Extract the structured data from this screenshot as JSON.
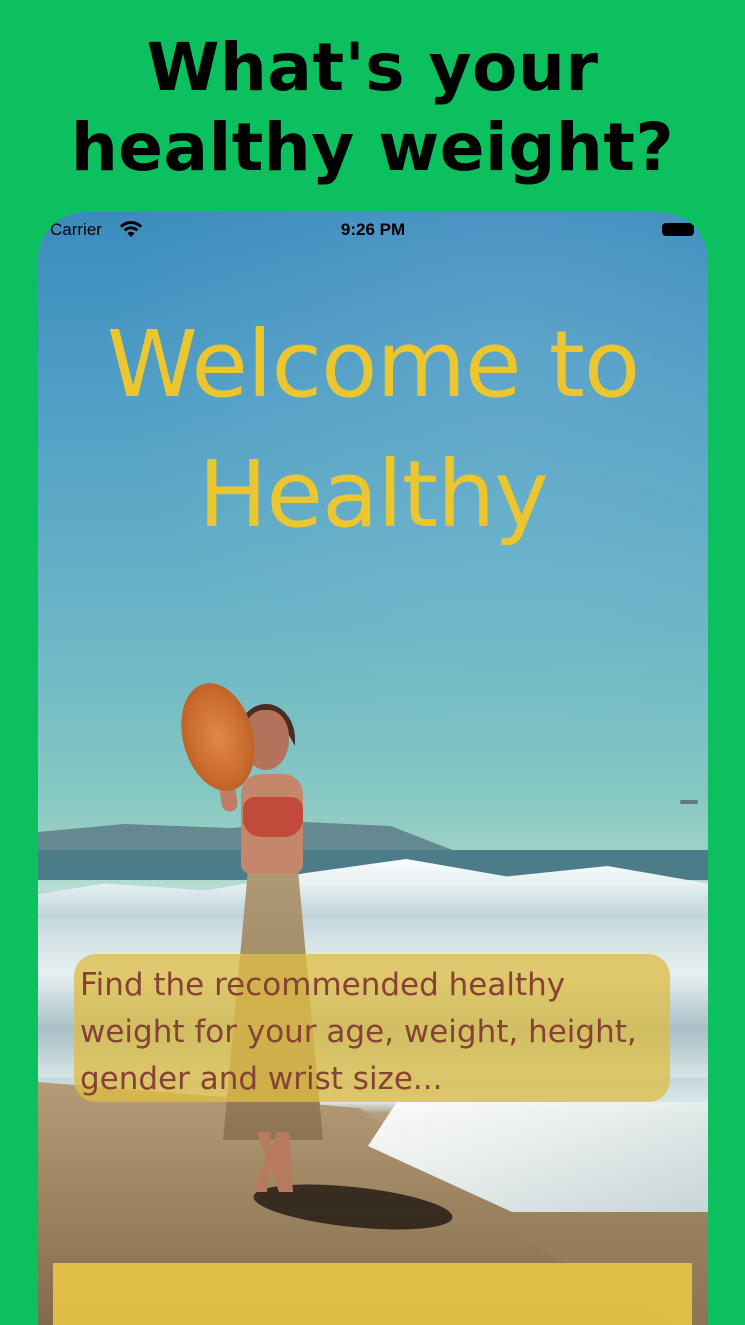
{
  "promo": {
    "headline": "What's your healthy weight?"
  },
  "status_bar": {
    "carrier": "Carrier",
    "time": "9:26 PM",
    "wifi_icon": "wifi-icon",
    "battery_icon": "battery-icon"
  },
  "welcome": {
    "title": "Welcome to Healthy"
  },
  "description": {
    "text": "Find the recommended healthy weight for your age, weight, height, gender and wrist size..."
  },
  "colors": {
    "background": "#0cbf5f",
    "title": "#ecc62f",
    "description_text": "#874135",
    "description_box": "#debe46",
    "button": "#e8c446"
  }
}
